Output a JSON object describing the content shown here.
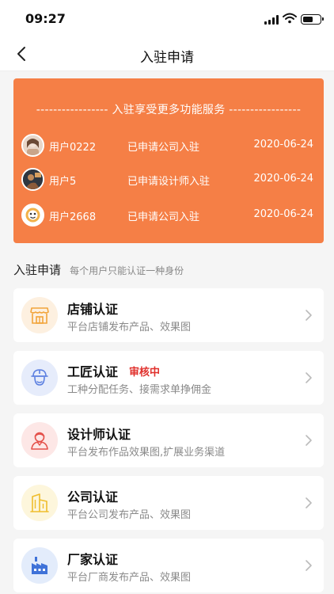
{
  "status_bar": {
    "time": "09:27"
  },
  "nav": {
    "title": "入驻申请"
  },
  "banner": {
    "title": "----------------- 入驻享受更多功能服务 -----------------",
    "background": "#f57f46",
    "records": [
      {
        "user": "用户0222",
        "action": "已申请公司入驻",
        "date": "2020-06-24"
      },
      {
        "user": "用户5",
        "action": "已申请设计师入驻",
        "date": "2020-06-24"
      },
      {
        "user": "用户2668",
        "action": "已申请公司入驻",
        "date": "2020-06-24"
      }
    ]
  },
  "section": {
    "title": "入驻申请",
    "subtitle": "每个用户只能认证一种身份"
  },
  "cards": [
    {
      "title": "店铺认证",
      "badge": "",
      "desc": "平台店铺发布产品、效果图",
      "icon": "store-icon"
    },
    {
      "title": "工匠认证",
      "badge": "审核中",
      "desc": "工种分配任务、接需求单挣佣金",
      "icon": "worker-helmet-icon"
    },
    {
      "title": "设计师认证",
      "badge": "",
      "desc": "平台发布作品效果图,扩展业务渠道",
      "icon": "designer-icon"
    },
    {
      "title": "公司认证",
      "badge": "",
      "desc": "平台公司发布产品、效果图",
      "icon": "company-building-icon"
    },
    {
      "title": "厂家认证",
      "badge": "",
      "desc": "平台厂商发布产品、效果图",
      "icon": "factory-icon"
    }
  ],
  "colors": {
    "accent": "#f57f46",
    "badge": "#e0302c"
  }
}
